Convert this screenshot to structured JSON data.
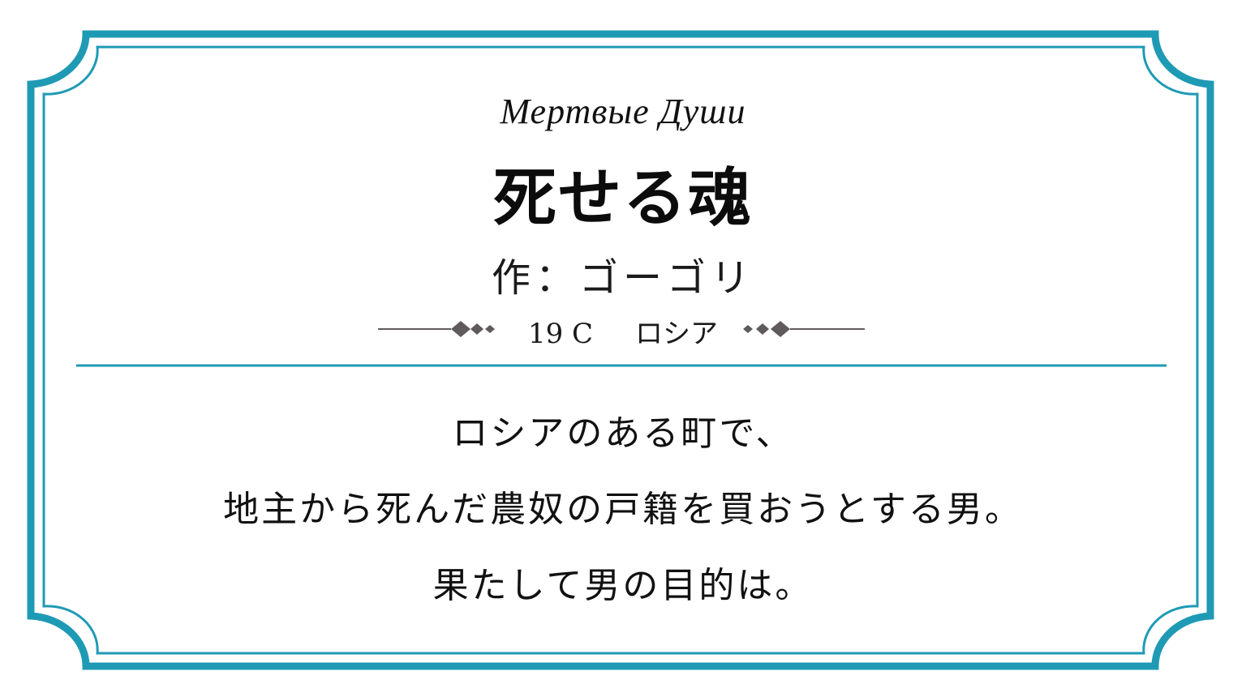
{
  "card": {
    "original_title": "Мертвые Души",
    "title": "死せる魂",
    "author": "作：ゴーゴリ",
    "era": "19 C",
    "country": "ロシア",
    "summary": [
      "ロシアのある町で、",
      "地主から死んだ農奴の戸籍を買おうとする男。",
      "果たして男の目的は。"
    ]
  },
  "colors": {
    "frame": "#1f9ab5",
    "ornament": "#5f5a5c",
    "text": "#111111",
    "background": "#ffffff"
  }
}
